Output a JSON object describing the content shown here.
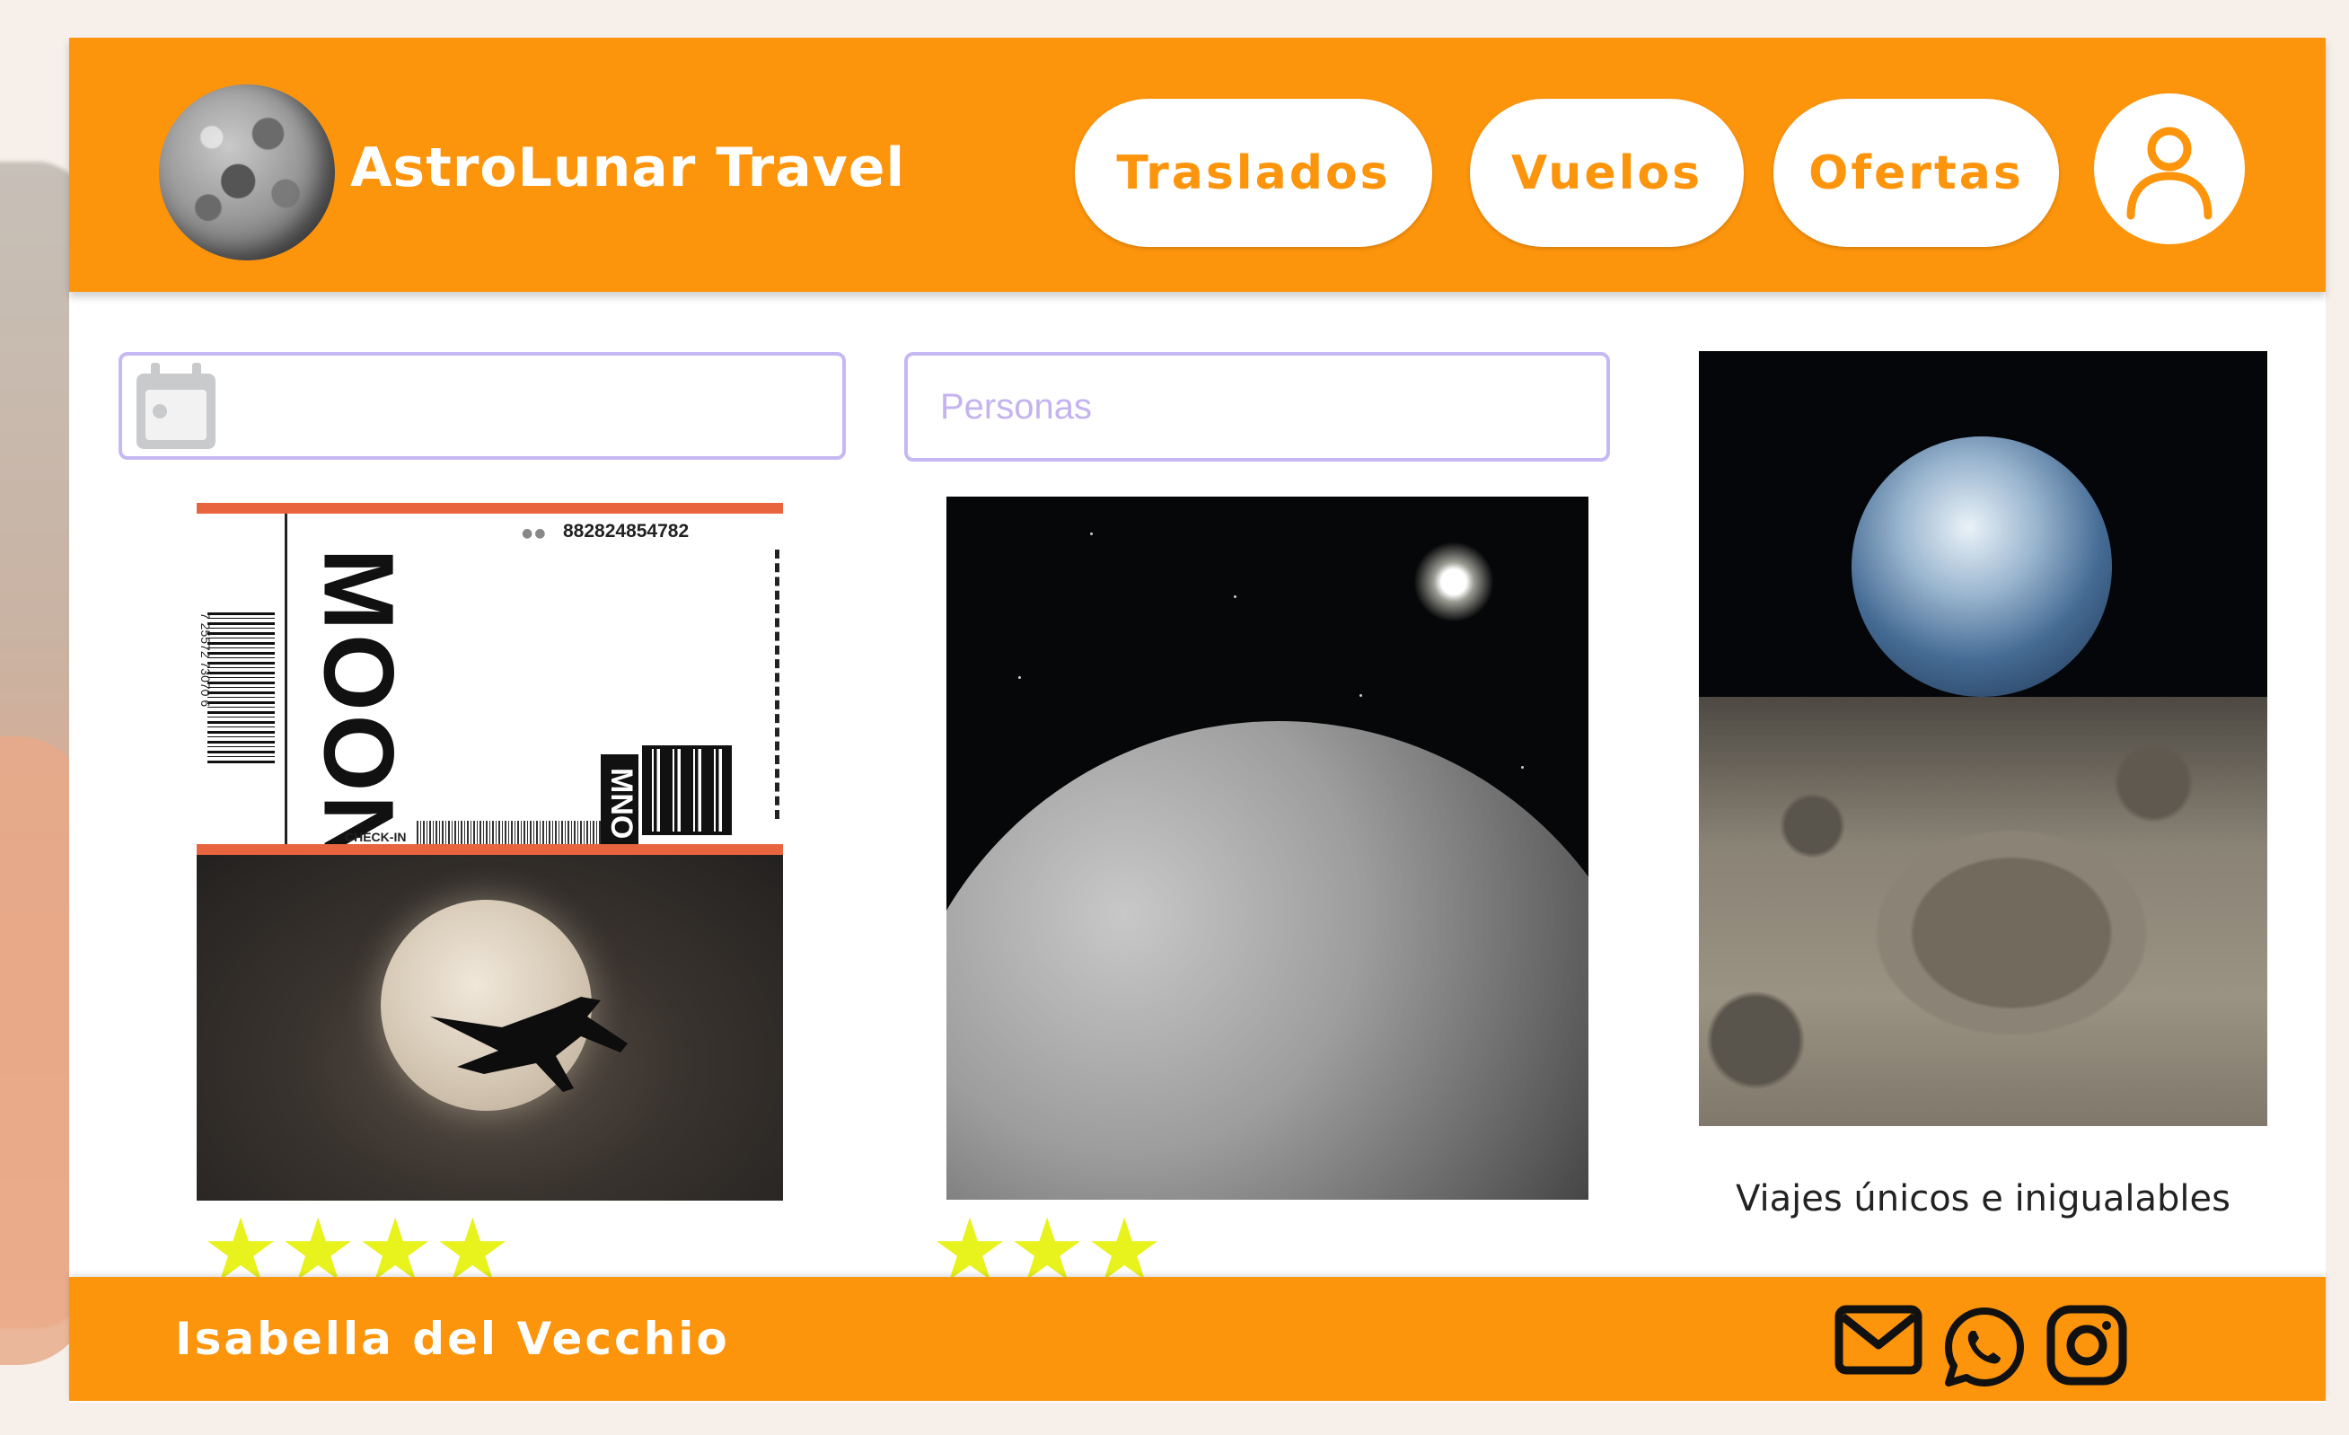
{
  "header": {
    "brand": "AstroLunar Travel",
    "nav": [
      {
        "label": "Traslados"
      },
      {
        "label": "Vuelos"
      },
      {
        "label": "Ofertas"
      }
    ]
  },
  "search": {
    "date_placeholder": "",
    "people_placeholder": "Personas"
  },
  "ticket": {
    "code": "882824854782",
    "title": "MOON",
    "barcode_number": "7 25572 73070 6",
    "checkin": "CHECK-IN",
    "tag": "MNO"
  },
  "cards": [
    {
      "rating": 4,
      "stars": "★★★★"
    },
    {
      "rating": 3,
      "stars": "★★★"
    }
  ],
  "caption": "Viajes únicos e inigualables",
  "footer": {
    "author": "Isabella del Vecchio"
  },
  "colors": {
    "accent": "#fc940c",
    "input_border": "#c6b8f3",
    "star": "#e8f21c"
  },
  "icons": [
    "user-icon",
    "calendar-icon",
    "mail-icon",
    "whatsapp-icon",
    "instagram-icon"
  ]
}
